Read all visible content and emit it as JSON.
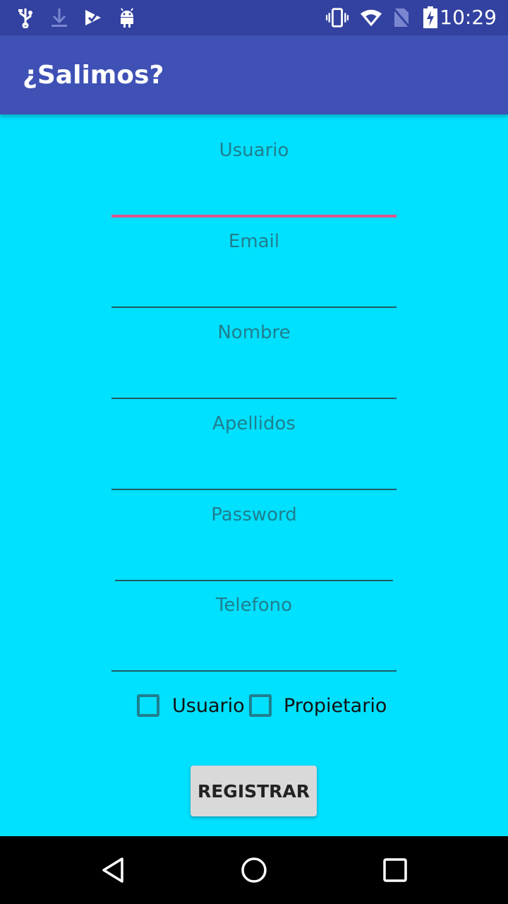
{
  "status_bar": {
    "time": "10:29",
    "icons": [
      "usb-icon",
      "download-icon",
      "play-check-icon",
      "android-icon",
      "vibrate-icon",
      "wifi-icon",
      "no-sim-icon",
      "battery-charging-icon"
    ]
  },
  "app_bar": {
    "title": "¿Salimos?"
  },
  "form": {
    "fields": [
      {
        "label": "Usuario",
        "value": "",
        "focused": true
      },
      {
        "label": "Email",
        "value": ""
      },
      {
        "label": "Nombre",
        "value": ""
      },
      {
        "label": "Apellidos",
        "value": ""
      },
      {
        "label": "Password",
        "value": ""
      },
      {
        "label": "Telefono",
        "value": ""
      }
    ],
    "checkboxes": [
      {
        "label": "Usuario",
        "checked": false
      },
      {
        "label": "Propietario",
        "checked": false
      }
    ],
    "register_label": "REGISTRAR"
  },
  "colors": {
    "background": "#00E0FF",
    "app_bar": "#3F51B5",
    "status_bar": "#3342A0",
    "accent": "#E0568F"
  },
  "nav_bar": {
    "buttons": [
      "back-icon",
      "home-icon",
      "recents-icon"
    ]
  }
}
